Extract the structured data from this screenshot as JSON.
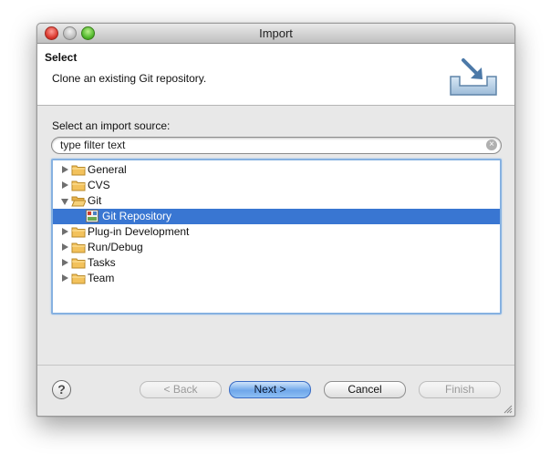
{
  "window": {
    "title": "Import"
  },
  "header": {
    "title": "Select",
    "description": "Clone an existing Git repository.",
    "icon": "import-wizard-icon"
  },
  "source": {
    "label": "Select an import source:"
  },
  "filter": {
    "value": "type filter text",
    "placeholder": "type filter text"
  },
  "tree": {
    "items": [
      {
        "label": "General",
        "expanded": false,
        "icon": "folder-icon"
      },
      {
        "label": "CVS",
        "expanded": false,
        "icon": "folder-icon"
      },
      {
        "label": "Git",
        "expanded": true,
        "icon": "folder-open-icon"
      },
      {
        "label": "Git Repository",
        "child": true,
        "selected": true,
        "icon": "git-repository-icon"
      },
      {
        "label": "Plug-in Development",
        "expanded": false,
        "icon": "folder-icon"
      },
      {
        "label": "Run/Debug",
        "expanded": false,
        "icon": "folder-icon"
      },
      {
        "label": "Tasks",
        "expanded": false,
        "icon": "folder-icon"
      },
      {
        "label": "Team",
        "expanded": false,
        "icon": "folder-icon"
      }
    ]
  },
  "buttons": {
    "help": "?",
    "back": "< Back",
    "next": "Next >",
    "cancel": "Cancel",
    "finish": "Finish"
  },
  "colors": {
    "selection": "#3976d2",
    "focus_ring": "#86b1e1",
    "default_button": "#6fa7ea"
  }
}
